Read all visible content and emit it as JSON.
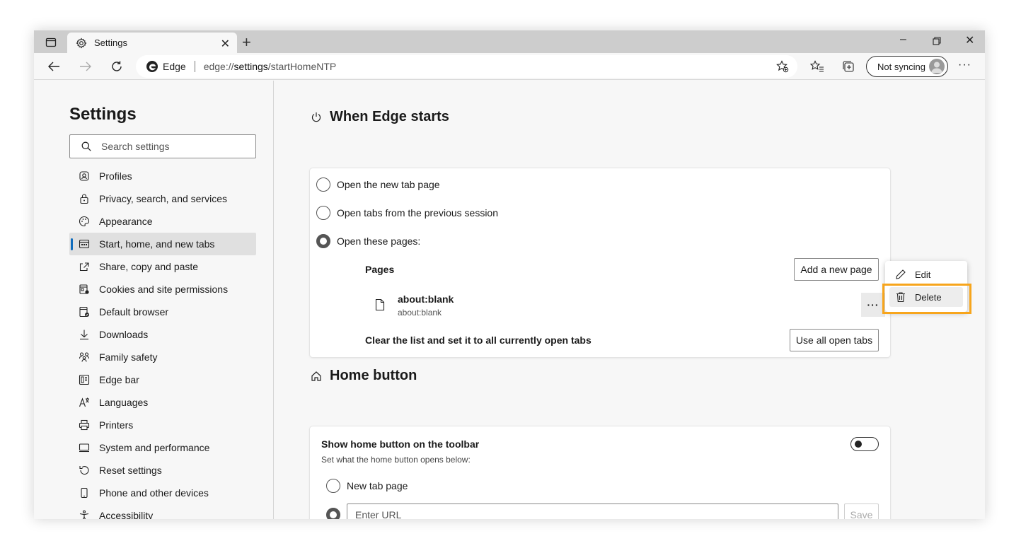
{
  "browser": {
    "tab_title": "Settings",
    "address_site": "Edge",
    "address_url_prefix": "edge://",
    "address_url_bold": "settings",
    "address_url_suffix": "/startHomeNTP",
    "sync_label": "Not syncing"
  },
  "sidebar": {
    "title": "Settings",
    "search_placeholder": "Search settings",
    "items": [
      {
        "label": "Profiles",
        "icon": "profile-icon"
      },
      {
        "label": "Privacy, search, and services",
        "icon": "lock-icon"
      },
      {
        "label": "Appearance",
        "icon": "palette-icon"
      },
      {
        "label": "Start, home, and new tabs",
        "icon": "start-home-icon",
        "active": true
      },
      {
        "label": "Share, copy and paste",
        "icon": "share-icon"
      },
      {
        "label": "Cookies and site permissions",
        "icon": "cookies-icon"
      },
      {
        "label": "Default browser",
        "icon": "default-browser-icon"
      },
      {
        "label": "Downloads",
        "icon": "download-icon"
      },
      {
        "label": "Family safety",
        "icon": "family-icon"
      },
      {
        "label": "Edge bar",
        "icon": "edge-bar-icon"
      },
      {
        "label": "Languages",
        "icon": "languages-icon"
      },
      {
        "label": "Printers",
        "icon": "printer-icon"
      },
      {
        "label": "System and performance",
        "icon": "system-icon"
      },
      {
        "label": "Reset settings",
        "icon": "reset-icon"
      },
      {
        "label": "Phone and other devices",
        "icon": "phone-icon"
      },
      {
        "label": "Accessibility",
        "icon": "accessibility-icon"
      }
    ]
  },
  "startup": {
    "title": "When Edge starts",
    "option_new_tab": "Open the new tab page",
    "option_previous": "Open tabs from the previous session",
    "option_pages": "Open these pages:",
    "pages_heading": "Pages",
    "add_page_button": "Add a new page",
    "page_title": "about:blank",
    "page_url": "about:blank",
    "clear_text": "Clear the list and set it to all currently open tabs",
    "use_open_tabs_button": "Use all open tabs"
  },
  "context_menu": {
    "edit": "Edit",
    "delete": "Delete"
  },
  "home": {
    "title": "Home button",
    "show_label": "Show home button on the toolbar",
    "show_desc": "Set what the home button opens below:",
    "option_new_tab": "New tab page",
    "url_placeholder": "Enter URL",
    "save_button": "Save",
    "toggle_on": false
  },
  "colors": {
    "accent": "#0f6cbd",
    "highlight": "#f7a51c"
  }
}
